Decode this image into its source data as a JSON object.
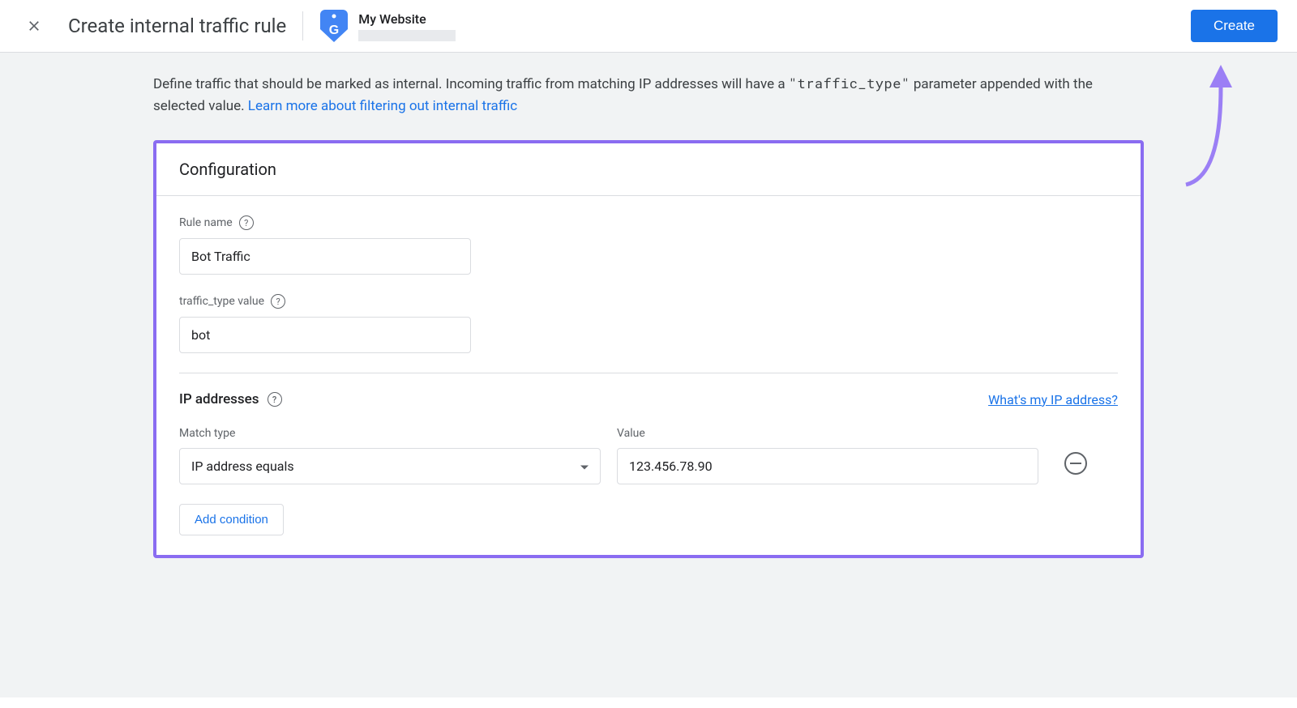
{
  "header": {
    "title": "Create internal traffic rule",
    "site_name": "My Website",
    "create_button": "Create"
  },
  "description": {
    "text_before": "Define traffic that should be marked as internal. Incoming traffic from matching IP addresses will have a ",
    "code": "\"traffic_type\"",
    "text_after": " parameter appended with the selected value. ",
    "link": "Learn more about filtering out internal traffic"
  },
  "card": {
    "title": "Configuration",
    "rule_name_label": "Rule name",
    "rule_name_value": "Bot Traffic",
    "traffic_type_label": "traffic_type value",
    "traffic_type_value": "bot",
    "ip_section_title": "IP addresses",
    "ip_link": "What's my IP address?",
    "match_type_label": "Match type",
    "match_type_value": "IP address equals",
    "value_label": "Value",
    "value_input": "123.456.78.90",
    "add_condition": "Add condition"
  }
}
